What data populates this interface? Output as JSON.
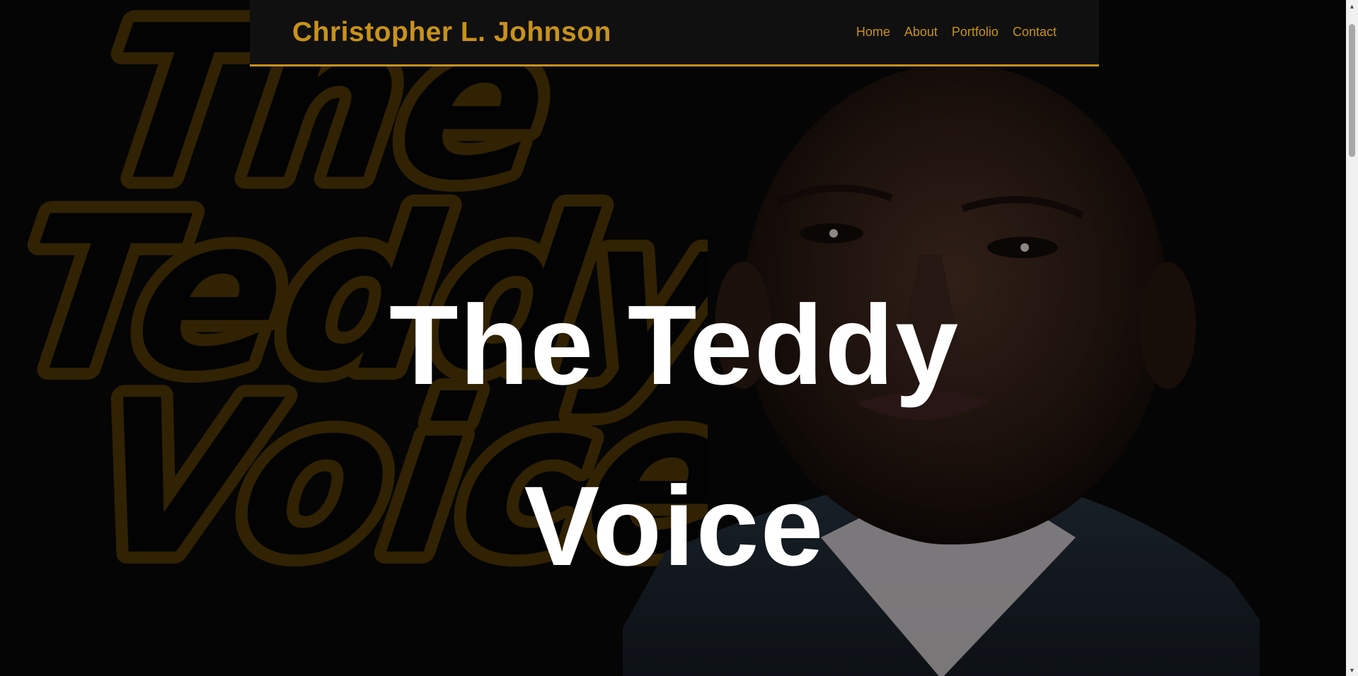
{
  "header": {
    "brand": "Christopher L. Johnson",
    "nav": [
      {
        "label": "Home"
      },
      {
        "label": "About"
      },
      {
        "label": "Portfolio"
      },
      {
        "label": "Contact"
      }
    ]
  },
  "hero": {
    "title_line_1": "The Teddy",
    "title_line_2": "Voice",
    "background_logo_text": [
      "The",
      "Teddy",
      "Voice"
    ]
  },
  "colors": {
    "accent": "#c8921b",
    "header_bg": "#101010",
    "page_bg": "#080808",
    "title": "#ffffff"
  },
  "icons": {
    "scroll_up": "triangle-up",
    "scroll_down": "triangle-down"
  }
}
